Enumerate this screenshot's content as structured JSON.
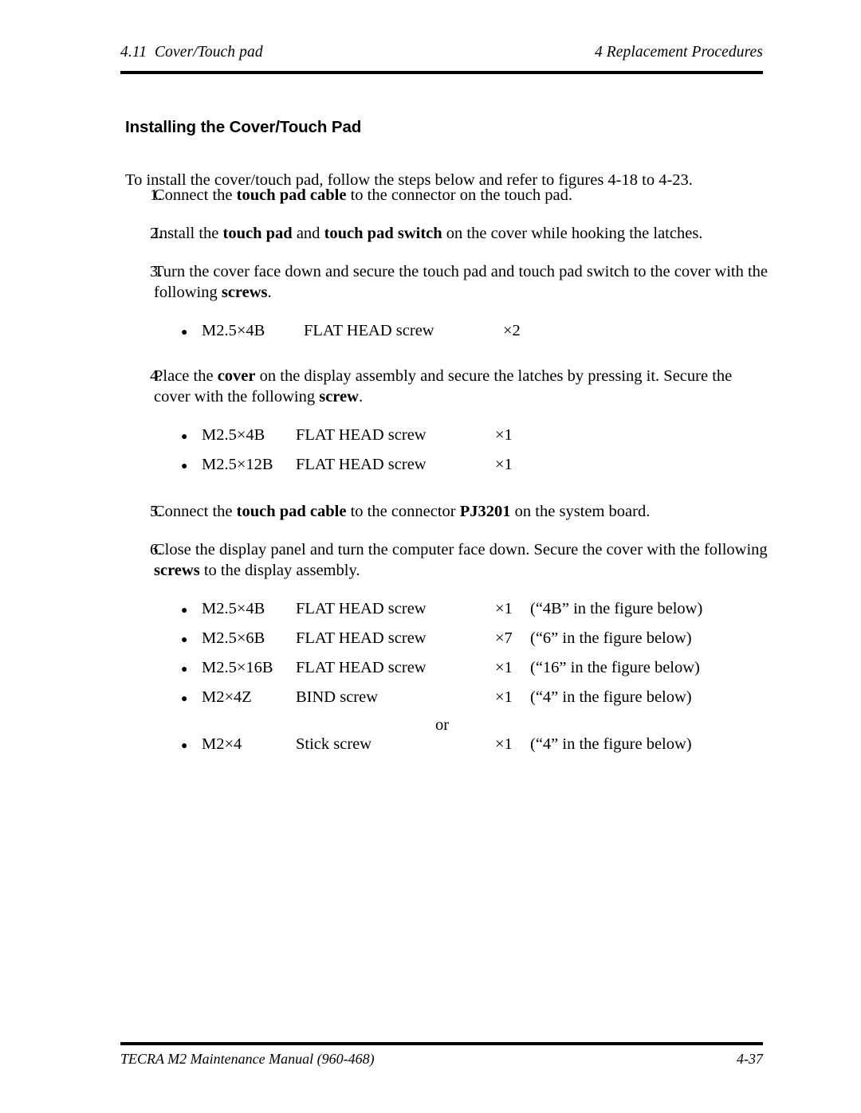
{
  "header": {
    "left": "4.11  Cover/Touch pad",
    "right": "4 Replacement Procedures"
  },
  "title": "Installing the Cover/Touch Pad",
  "intro": "To install the cover/touch pad, follow the steps below and refer to figures 4-18 to 4-23.",
  "steps": [
    {
      "number": "1.",
      "parts": [
        {
          "text": "Connect the ",
          "bold": false
        },
        {
          "text": "touch pad cable",
          "bold": true
        },
        {
          "text": " to the connector on the touch pad.",
          "bold": false
        }
      ]
    },
    {
      "number": "2.",
      "parts": [
        {
          "text": "Install the ",
          "bold": false
        },
        {
          "text": "touch pad",
          "bold": true
        },
        {
          "text": " and ",
          "bold": false
        },
        {
          "text": "touch pad switch",
          "bold": true
        },
        {
          "text": " on the cover while hooking the latches.",
          "bold": false
        }
      ]
    },
    {
      "number": "3.",
      "parts": [
        {
          "text": "Turn the cover face down and secure the touch pad and touch pad switch to the cover with the following ",
          "bold": false
        },
        {
          "text": "screws",
          "bold": true
        },
        {
          "text": ".",
          "bold": false
        }
      ]
    },
    {
      "number": "4.",
      "parts": [
        {
          "text": "Place the ",
          "bold": false
        },
        {
          "text": "cover",
          "bold": true
        },
        {
          "text": " on the display assembly and secure the latches by pressing it. Secure the cover with the following ",
          "bold": false
        },
        {
          "text": "screw",
          "bold": true
        },
        {
          "text": ".",
          "bold": false
        }
      ]
    },
    {
      "number": "5.",
      "parts": [
        {
          "text": "Connect the ",
          "bold": false
        },
        {
          "text": "touch pad cable",
          "bold": true
        },
        {
          "text": " to the connector ",
          "bold": false
        },
        {
          "text": "PJ3201",
          "bold": true
        },
        {
          "text": " on the system board.",
          "bold": false
        }
      ]
    },
    {
      "number": "6.",
      "parts": [
        {
          "text": "Close the display panel and turn the computer face down. Secure the cover with the following ",
          "bold": false
        },
        {
          "text": "screws",
          "bold": true
        },
        {
          "text": " to the display assembly.",
          "bold": false
        }
      ]
    }
  ],
  "bullet_glyph": "●",
  "screw_lists": {
    "step3": [
      {
        "size": "M2.5×4B",
        "kind": "FLAT HEAD screw",
        "qty": "×2",
        "note": ""
      }
    ],
    "step4": [
      {
        "size": "M2.5×4B",
        "kind": "FLAT HEAD screw",
        "qty": "×1",
        "note": ""
      },
      {
        "size": "M2.5×12B",
        "kind": "FLAT HEAD screw",
        "qty": "×1",
        "note": ""
      }
    ],
    "step6_a": [
      {
        "size": "M2.5×4B",
        "kind": "FLAT HEAD screw",
        "qty": "×1",
        "note": "(“4B” in the figure below)"
      },
      {
        "size": "M2.5×6B",
        "kind": "FLAT HEAD screw",
        "qty": "×7",
        "note": "(“6” in the figure below)"
      },
      {
        "size": "M2.5×16B",
        "kind": "FLAT HEAD screw",
        "qty": "×1",
        "note": "(“16” in the figure below)"
      },
      {
        "size": "M2×4Z",
        "kind": "BIND screw",
        "qty": "×1",
        "note": "(“4” in the figure below)"
      }
    ],
    "or_label": "or",
    "step6_b": [
      {
        "size": "M2×4",
        "kind": "Stick screw",
        "qty": "×1",
        "note": "(“4” in the figure below)"
      }
    ]
  },
  "footer": {
    "left": "TECRA M2 Maintenance Manual (960-468)",
    "right": "4-37"
  }
}
